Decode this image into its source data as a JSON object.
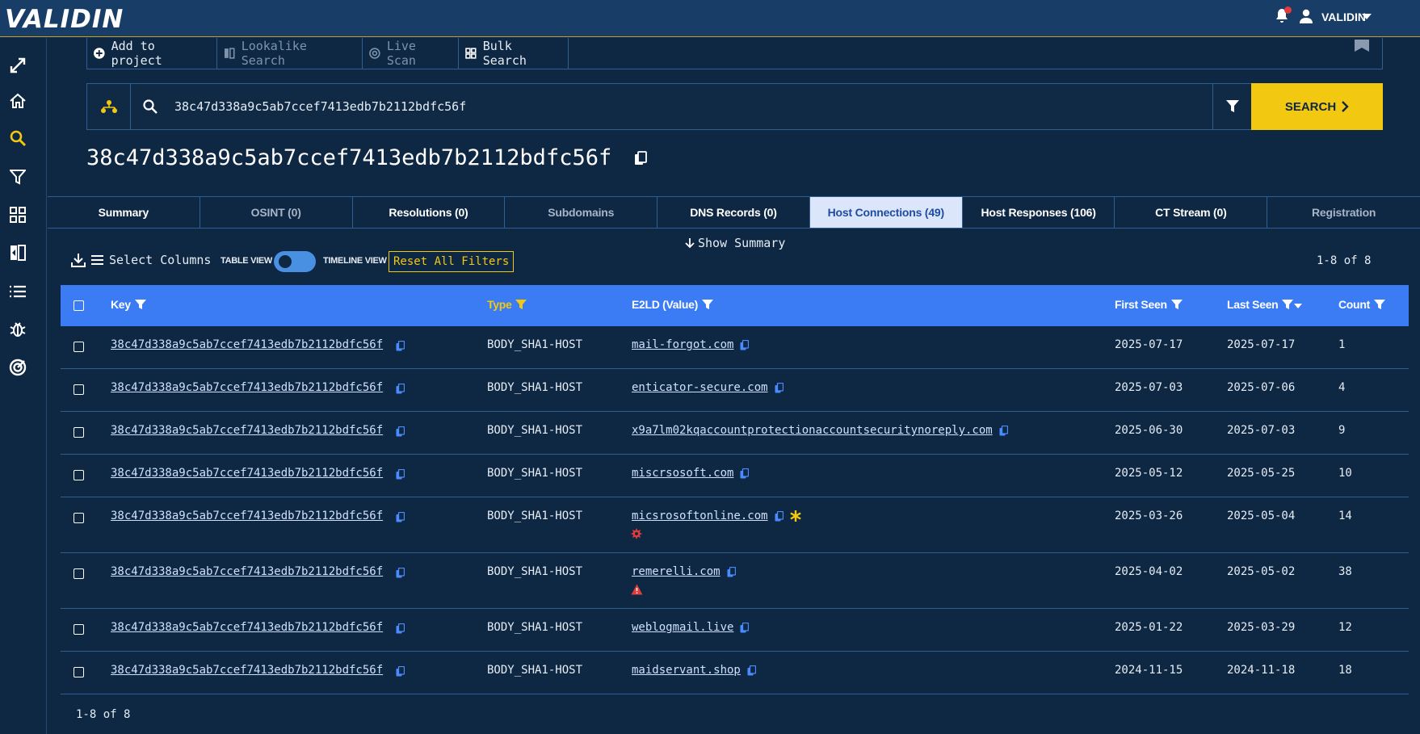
{
  "app": {
    "logo": "VALIDIN",
    "user": "VALIDIN"
  },
  "actions": {
    "add_project": "Add to project",
    "lookalike": "Lookalike Search",
    "live_scan": "Live Scan",
    "bulk": "Bulk Search"
  },
  "search": {
    "value": "38c47d338a9c5ab7ccef7413edb7b2112bdfc56f",
    "button": "SEARCH"
  },
  "title": "38c47d338a9c5ab7ccef7413edb7b2112bdfc56f",
  "tabs": [
    {
      "label": "Summary"
    },
    {
      "label": "OSINT (0)"
    },
    {
      "label": "Resolutions (0)"
    },
    {
      "label": "Subdomains"
    },
    {
      "label": "DNS Records (0)"
    },
    {
      "label": "Host Connections (49)"
    },
    {
      "label": "Host Responses (106)"
    },
    {
      "label": "CT Stream (0)"
    },
    {
      "label": "Registration"
    }
  ],
  "show_summary": "Show Summary",
  "toolbar": {
    "select_columns": "Select Columns",
    "table_view": "TABLE VIEW",
    "timeline_view": "TIMELINE VIEW",
    "reset": "Reset All Filters",
    "count": "1-8 of 8"
  },
  "columns": {
    "key": "Key",
    "type": "Type",
    "e2ld": "E2LD (Value)",
    "first": "First Seen",
    "last": "Last Seen",
    "count": "Count"
  },
  "rows": [
    {
      "key": "38c47d338a9c5ab7ccef7413edb7b2112bdfc56f",
      "type": "BODY_SHA1-HOST",
      "value": "mail-forgot.com",
      "first": "2025-07-17",
      "last": "2025-07-17",
      "count": "1"
    },
    {
      "key": "38c47d338a9c5ab7ccef7413edb7b2112bdfc56f",
      "type": "BODY_SHA1-HOST",
      "value": "enticator-secure.com",
      "first": "2025-07-03",
      "last": "2025-07-06",
      "count": "4"
    },
    {
      "key": "38c47d338a9c5ab7ccef7413edb7b2112bdfc56f",
      "type": "BODY_SHA1-HOST",
      "value": "x9a7lm02kqaccountprotectionaccountsecuritynoreply.com",
      "first": "2025-06-30",
      "last": "2025-07-03",
      "count": "9"
    },
    {
      "key": "38c47d338a9c5ab7ccef7413edb7b2112bdfc56f",
      "type": "BODY_SHA1-HOST",
      "value": "miscrsosoft.com",
      "first": "2025-05-12",
      "last": "2025-05-25",
      "count": "10"
    },
    {
      "key": "38c47d338a9c5ab7ccef7413edb7b2112bdfc56f",
      "type": "BODY_SHA1-HOST",
      "value": "micsrosoftonline.com",
      "first": "2025-03-26",
      "last": "2025-05-04",
      "count": "14"
    },
    {
      "key": "38c47d338a9c5ab7ccef7413edb7b2112bdfc56f",
      "type": "BODY_SHA1-HOST",
      "value": "remerelli.com",
      "first": "2025-04-02",
      "last": "2025-05-02",
      "count": "38"
    },
    {
      "key": "38c47d338a9c5ab7ccef7413edb7b2112bdfc56f",
      "type": "BODY_SHA1-HOST",
      "value": "weblogmail.live",
      "first": "2025-01-22",
      "last": "2025-03-29",
      "count": "12"
    },
    {
      "key": "38c47d338a9c5ab7ccef7413edb7b2112bdfc56f",
      "type": "BODY_SHA1-HOST",
      "value": "maidservant.shop",
      "first": "2024-11-15",
      "last": "2024-11-18",
      "count": "18"
    }
  ],
  "footer_count": "1-8 of 8",
  "colors": {
    "accent": "#f2c811",
    "header": "#3b7cf5",
    "bg": "#0e2743",
    "alert": "#e23b3b"
  }
}
